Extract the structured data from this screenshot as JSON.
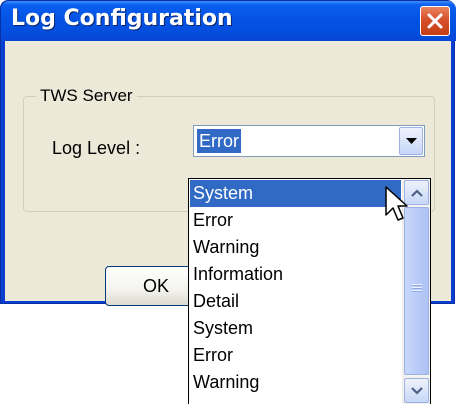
{
  "window": {
    "title": "Log Configuration",
    "close_icon": "close-icon"
  },
  "group": {
    "legend": "TWS Server"
  },
  "log_level": {
    "label": "Log Level :",
    "selected_value": "Error",
    "dropdown_icon": "chevron-down-icon"
  },
  "buttons": {
    "ok_label": "OK"
  },
  "dropdown": {
    "highlighted_index": 0,
    "options": [
      {
        "label": "System"
      },
      {
        "label": "Error"
      },
      {
        "label": "Warning"
      },
      {
        "label": "Information"
      },
      {
        "label": "Detail"
      },
      {
        "label": "System"
      },
      {
        "label": "Error"
      },
      {
        "label": "Warning"
      }
    ],
    "scroll_up_icon": "chevron-up-icon",
    "scroll_down_icon": "chevron-down-icon",
    "cursor_icon": "arrow-pointer-icon"
  },
  "colors": {
    "titlebar": "#0553e5",
    "client_background": "#ece9d8",
    "selection": "#316ac5",
    "close_button": "#d6502b"
  }
}
